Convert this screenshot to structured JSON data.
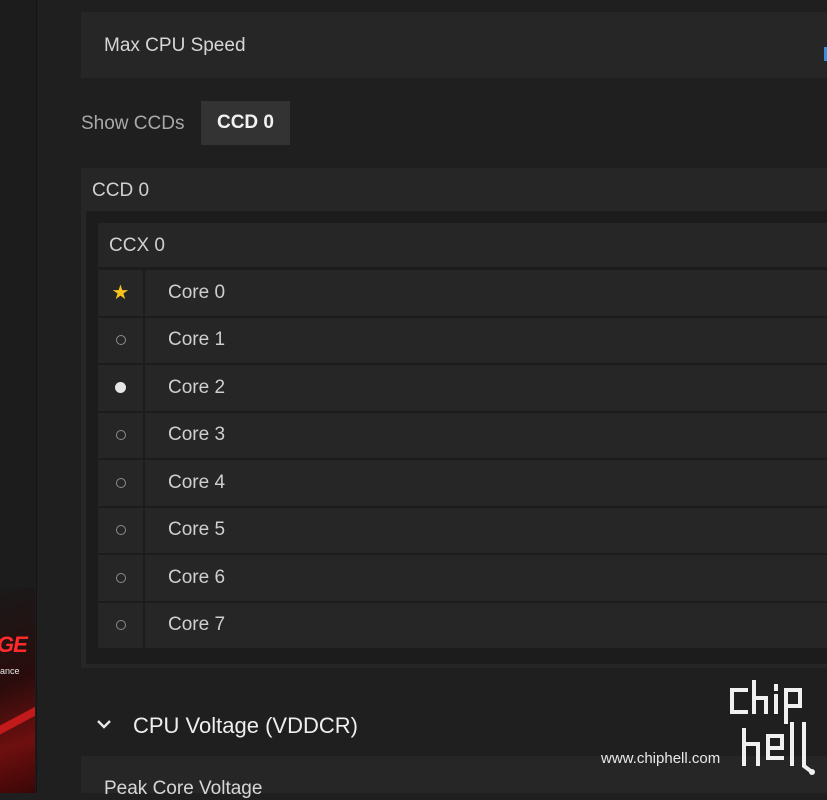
{
  "max_cpu": {
    "label": "Max CPU Speed"
  },
  "ccd_selector": {
    "label": "Show CCDs",
    "chip": "CCD 0"
  },
  "ccd": {
    "title": "CCD 0",
    "ccx": {
      "title": "CCX 0",
      "cores": [
        {
          "name": "Core 0",
          "marker": "star-icon"
        },
        {
          "name": "Core 1",
          "marker": "circle-outline-icon"
        },
        {
          "name": "Core 2",
          "marker": "circle-filled-icon"
        },
        {
          "name": "Core 3",
          "marker": "circle-outline-icon"
        },
        {
          "name": "Core 4",
          "marker": "circle-outline-icon"
        },
        {
          "name": "Core 5",
          "marker": "circle-outline-icon"
        },
        {
          "name": "Core 6",
          "marker": "circle-outline-icon"
        },
        {
          "name": "Core 7",
          "marker": "circle-outline-icon"
        }
      ]
    }
  },
  "voltage": {
    "title": "CPU Voltage (VDDCR)",
    "toggle_icon": "chevron-down-icon"
  },
  "peak": {
    "label": "Peak Core Voltage"
  },
  "promo": {
    "title_fragment": "GE",
    "subtitle_fragment": "ance"
  },
  "watermark": {
    "url": "www.chiphell.com",
    "logo_text": "chip hell"
  },
  "colors": {
    "star": "#f6c21b",
    "accent": "#3d8bd9",
    "promo_red": "#ff2a2a"
  }
}
